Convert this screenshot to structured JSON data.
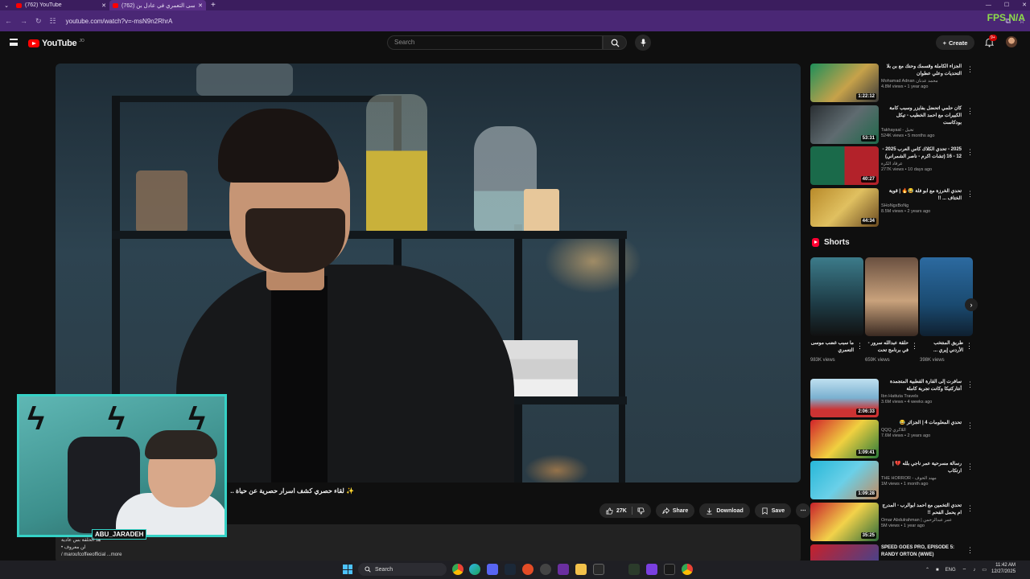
{
  "browser": {
    "tabs": [
      {
        "title": "(762) YouTube",
        "active": false
      },
      {
        "title": "(762) موسى التعمري في عادل بن",
        "active": true
      }
    ],
    "url": "youtube.com/watch?v=-msN9n2RhrA",
    "fps_overlay": "FPS N/A"
  },
  "header": {
    "logo": "YouTube",
    "logo_country": "JO",
    "search_placeholder": "Search",
    "create_label": "Create",
    "notification_count": "9+"
  },
  "video": {
    "title": "✨ لقاء حصري كشف اسرار حصرية عن حياة ..",
    "likes": "27K",
    "share_label": "Share",
    "download_label": "Download",
    "save_label": "Save",
    "description_lines": [
      "هذ الحلقة بس عادية",
      "• لن معروف",
      "/ maroufcoffeeofficial ...more"
    ]
  },
  "overlay": {
    "streamer_name": "ABU_JARADEH"
  },
  "recommendations_top": [
    {
      "title": "الجزاء الكاملة وقسمك وحنك مع بن بلا التحديات وعلي عطوان",
      "channel": "Mohamad Adnan محمد عدنان",
      "meta": "4.8M views • 1 year ago",
      "duration": "1:22:12",
      "rtl": true
    },
    {
      "title": "كان حلمي اتحضل بفايزر وسبب كامة الكبيرات مع احمد الخطيب - تيكل بودكاست",
      "channel": "Takhayaal - تخيل",
      "meta": "524K views • 5 months ago",
      "duration": "53:31",
      "rtl": true
    },
    {
      "title": "2025 - تحدي الكلاك كاس العرب 2025 - 12 - 16 (تشات اكرم - ناصر الشمراني)",
      "channel": "عرقاد الكرة",
      "meta": "277K views • 10 days ago",
      "duration": "40:27",
      "rtl": true
    },
    {
      "title": "تحدي الخرزة مع ابو فلة 😂🔥 | قوية الختاف ... !!",
      "channel": "SHoNgxBoNg",
      "meta": "8.5M views • 2 years ago",
      "duration": "44:34",
      "rtl": true
    }
  ],
  "shorts": {
    "heading": "Shorts",
    "items": [
      {
        "title": "ما سبب غضب موسى التعمري",
        "views": "983K views"
      },
      {
        "title": "حلقة عبدالله سرور - في برنامج تحت",
        "views": "659K views"
      },
      {
        "title": "طريق المنتخب الأردني إيري ...",
        "views": "398K views"
      }
    ]
  },
  "recommendations_bottom": [
    {
      "title": "سافرت إلى القارة القطبية المتجمدة أنتاركتيكا وكانت تجربة كاملة",
      "channel": "Ibn Hattuta Travels",
      "meta": "3.6M views • 4 weeks ago",
      "duration": "2:06:33",
      "rtl": true
    },
    {
      "title": "تحدي المعلومات 4 | الجزائر 😂",
      "channel": "QQQ اللاكري",
      "meta": "7.6M views • 2 years ago",
      "duration": "1:09:41",
      "rtl": true
    },
    {
      "title": "رسالة مسرحية عمر ناجي بلله 💔 | ارتكاب",
      "channel": "THE HORROR - مهند الخوف",
      "meta": "1M views • 1 month ago",
      "duration": "1:09:28",
      "rtl": true
    },
    {
      "title": "تحدي التخمين مع احمد ابوالرب - المدرج ام يحمل الفحم !!",
      "channel": "Omar Abdulrahman | عمر عبدالرحمن",
      "meta": "5M views • 1 year ago",
      "duration": "35:25",
      "rtl": true
    },
    {
      "title": "SPEED GOES PRO, EPISODE 5: RANDY ORTON (WWE)",
      "channel": "",
      "meta": "",
      "duration": "",
      "rtl": false
    }
  ],
  "taskbar": {
    "search_label": "Search",
    "language": "ENG",
    "time": "11:42 AM",
    "date": "12/27/2025"
  }
}
